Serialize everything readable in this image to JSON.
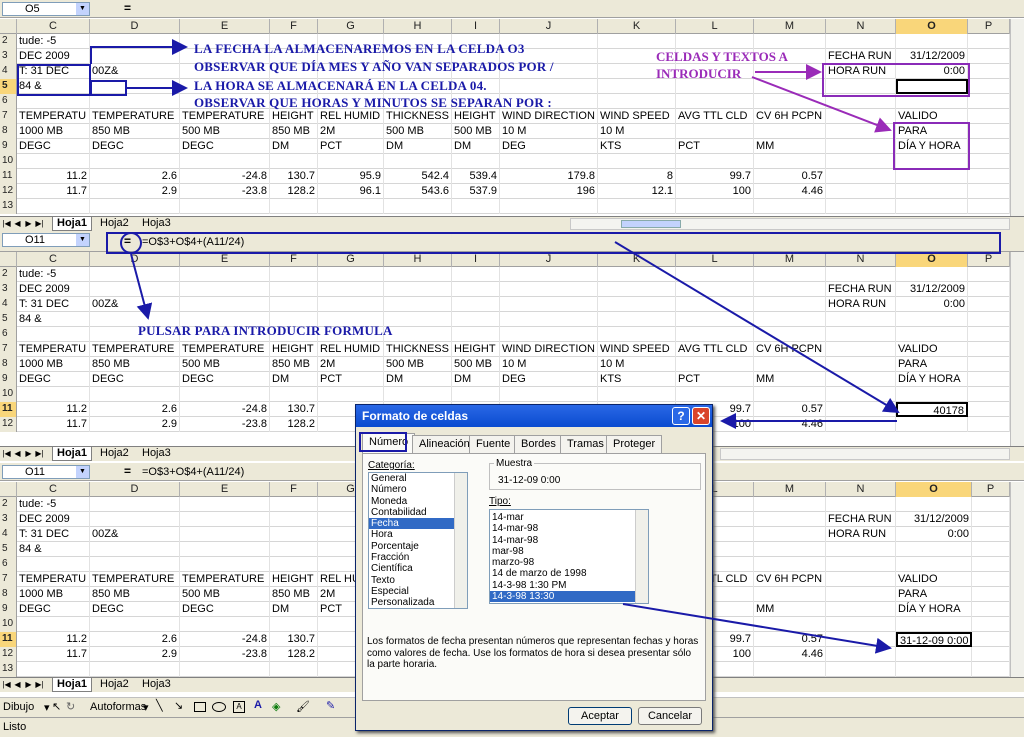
{
  "panes": [
    {
      "namebox": "O5",
      "formula": "",
      "sel_col": "O",
      "sel_row": "5"
    },
    {
      "namebox": "O11",
      "formula": "=O$3+O$4+(A11/24)",
      "sel_col": "O",
      "sel_row": "11"
    },
    {
      "namebox": "O11",
      "formula": "=O$3+O$4+(A11/24)",
      "sel_col": "O",
      "sel_row": "11"
    }
  ],
  "columns": [
    "C",
    "D",
    "E",
    "F",
    "G",
    "H",
    "I",
    "J",
    "K",
    "L",
    "M",
    "N",
    "O",
    "P"
  ],
  "rows": {
    "r2": {
      "num": "2",
      "C": "tude:  -5"
    },
    "r3": {
      "num": "3",
      "C": "DEC 2009",
      "N": "FECHA RUN",
      "O": "31/12/2009"
    },
    "r4": {
      "num": "4",
      "C": "T: 31 DEC",
      "D": "00Z&",
      "N": "HORA RUN",
      "O": "0:00"
    },
    "r5": {
      "num": "5",
      "C": "84 &"
    },
    "r6": {
      "num": "6"
    },
    "r7": {
      "num": "7",
      "C": "TEMPERATU",
      "D": "TEMPERATURE",
      "E": "TEMPERATURE",
      "F": "HEIGHT",
      "G": "REL HUMID",
      "H": "THICKNESS",
      "I": "HEIGHT",
      "J": "WIND DIRECTION",
      "K": "WIND SPEED",
      "L": "AVG TTL CLD",
      "M": "CV 6H PCPN",
      "O": "VALIDO"
    },
    "r8": {
      "num": "8",
      "C": "1000 MB",
      "D": "850 MB",
      "E": "500 MB",
      "F": "850 MB",
      "G": "2M",
      "H": "500 MB",
      "I": "500 MB",
      "J": "10 M",
      "K": "10 M",
      "O": "PARA"
    },
    "r9": {
      "num": "9",
      "C": "DEGC",
      "D": "DEGC",
      "E": "DEGC",
      "F": "DM",
      "G": "PCT",
      "H": "DM",
      "I": "DM",
      "J": "DEG",
      "K": "KTS",
      "L": "PCT",
      "M": "MM",
      "O": "DÍA Y HORA"
    },
    "r10": {
      "num": "10"
    },
    "r11": {
      "num": "11",
      "C": "11.2",
      "D": "2.6",
      "E": "-24.8",
      "F": "130.7",
      "G": "95.9",
      "H": "542.4",
      "I": "539.4",
      "J": "179.8",
      "K": "8",
      "L": "99.7",
      "M": "0.57"
    },
    "r12": {
      "num": "12",
      "C": "11.7",
      "D": "2.9",
      "E": "-23.8",
      "F": "128.2",
      "G": "96.1",
      "H": "543.6",
      "I": "537.9",
      "J": "196",
      "K": "12.1",
      "L": "100",
      "M": "4.46"
    },
    "r13": {
      "num": "13",
      "C": "",
      "D": "",
      "E": "",
      "F": "",
      "G": "",
      "H": "",
      "I": "",
      "J": "",
      "K": "",
      "L": "",
      "M": ""
    }
  },
  "o11_values": [
    "40178",
    "31-12-09 0:00"
  ],
  "sheets": [
    "Hoja1",
    "Hoja2",
    "Hoja3"
  ],
  "annotations": {
    "a1": "LA FECHA LA ALMACENAREMOS EN LA CELDA O3",
    "a2": "OBSERVAR QUE DÍA MES Y AÑO VAN SEPARADOS POR /",
    "a3": "LA HORA SE ALMACENARÁ EN LA CELDA 04.",
    "a4": "OBSERVAR QUE HORAS Y MINUTOS SE SEPARAN POR :",
    "p1": "CELDAS Y TEXTOS A",
    "p2": "INTRODUCIR",
    "b1": "PULSAR PARA INTRODUCIR FORMULA"
  },
  "dialog": {
    "title": "Formato de celdas",
    "tabs": [
      "Número",
      "Alineación",
      "Fuente",
      "Bordes",
      "Tramas",
      "Proteger"
    ],
    "categoria_label": "Categoría:",
    "categories": [
      "General",
      "Número",
      "Moneda",
      "Contabilidad",
      "Fecha",
      "Hora",
      "Porcentaje",
      "Fracción",
      "Científica",
      "Texto",
      "Especial",
      "Personalizada"
    ],
    "selected_category": "Fecha",
    "muestra_label": "Muestra",
    "muestra_value": "31-12-09 0:00",
    "tipo_label": "Tipo:",
    "types": [
      "14-mar",
      "14-mar-98",
      "14-mar-98",
      "mar-98",
      "marzo-98",
      "14 de marzo de 1998",
      "14-3-98 1:30 PM",
      "14-3-98 13:30"
    ],
    "selected_type": "14-3-98 13:30",
    "description": "Los formatos de fecha presentan números que representan fechas y horas como valores de fecha. Use los formatos de hora si desea presentar sólo la parte horaria.",
    "ok": "Aceptar",
    "cancel": "Cancelar"
  },
  "drawbar": {
    "dibujo": "Dibujo",
    "autoformas": "Autoformas"
  },
  "status": "Listo",
  "colors": {
    "annotation_blue": "#1a1aa8",
    "annotation_purple": "#9a2bb8",
    "title_blue": "#0a4bd0",
    "selection_blue": "#316ac5"
  }
}
